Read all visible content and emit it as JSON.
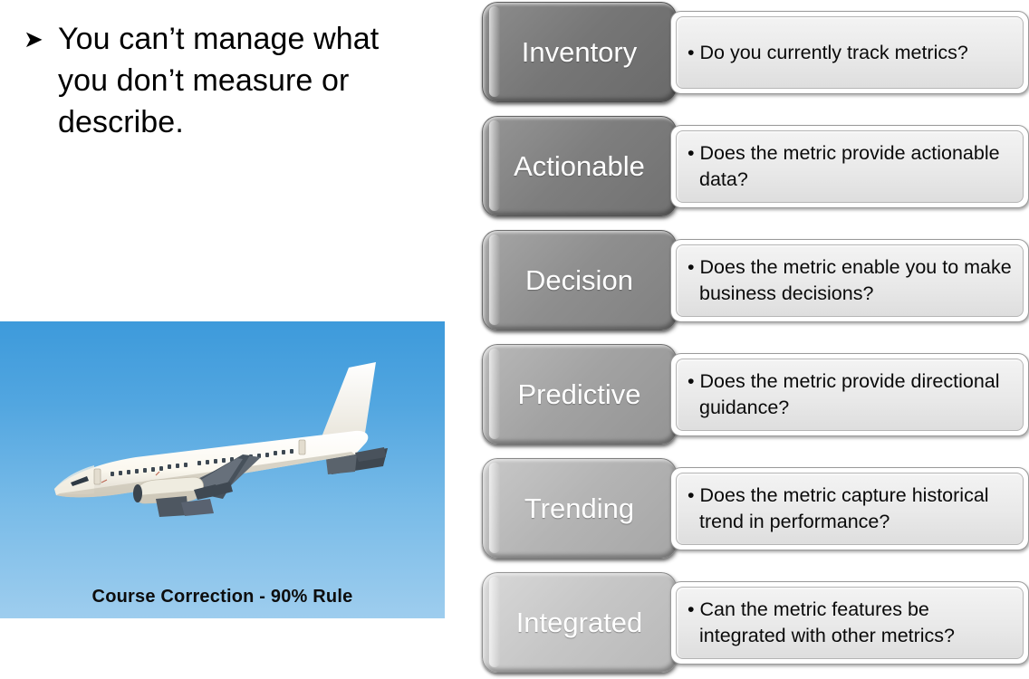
{
  "slide": {
    "bullet": {
      "marker": "➤",
      "text": "You can’t manage what you don’t measure or describe."
    },
    "photo": {
      "alt_name": "airplane-taking-off-photo",
      "caption": "Course Correction - 90% Rule",
      "sky_top_color": "#3d9adb",
      "sky_bottom_color": "#9ecdee",
      "aircraft_color": "#fbf9f2"
    },
    "diagram": {
      "type": "vertical-bullet-list",
      "rows": [
        {
          "label": "Inventory",
          "bullet": "Do you currently track metrics?",
          "chip_color": "#767676"
        },
        {
          "label": "Actionable",
          "bullet": "Does the metric provide actionable data?",
          "chip_color": "#7e7e7e"
        },
        {
          "label": "Decision",
          "bullet": "Does the metric enable you to make business decisions?",
          "chip_color": "#8e8e8e"
        },
        {
          "label": "Predictive",
          "bullet": "Does the metric provide directional guidance?",
          "chip_color": "#a2a2a2"
        },
        {
          "label": "Trending",
          "bullet": "Does the metric capture historical trend in performance?",
          "chip_color": "#b4b4b4"
        },
        {
          "label": "Integrated",
          "bullet": "Can the metric features be integrated with other metrics?",
          "chip_color": "#c6c6c6"
        }
      ]
    }
  }
}
